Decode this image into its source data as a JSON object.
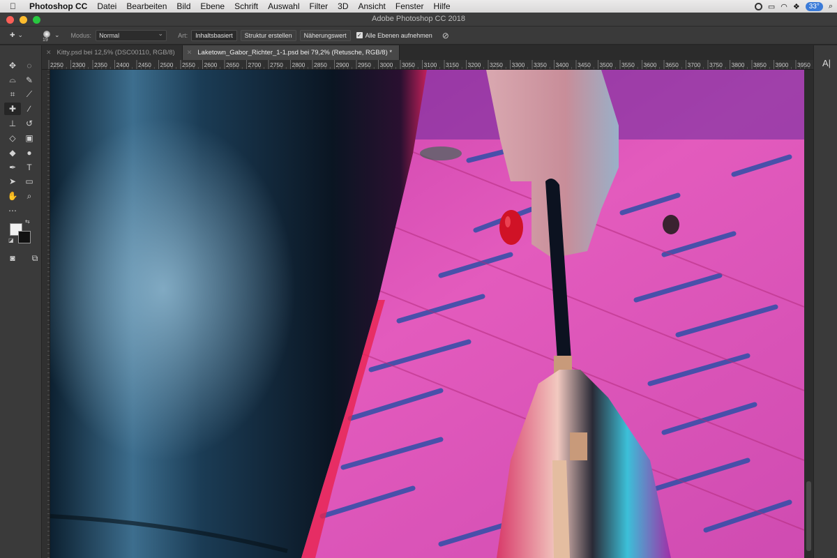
{
  "menubar": {
    "app": "Photoshop CC",
    "items": [
      "Datei",
      "Bearbeiten",
      "Bild",
      "Ebene",
      "Schrift",
      "Auswahl",
      "Filter",
      "3D",
      "Ansicht",
      "Fenster",
      "Hilfe"
    ],
    "temperature": "33°"
  },
  "window": {
    "title": "Adobe Photoshop CC 2018"
  },
  "options": {
    "brush_size": "19",
    "modus_label": "Modus:",
    "modus_value": "Normal",
    "art_label": "Art:",
    "btn_content_aware": "Inhaltsbasiert",
    "btn_create_texture": "Struktur erstellen",
    "btn_proximity": "Näherungswert",
    "sample_all_layers": "Alle Ebenen aufnehmen"
  },
  "tabs": [
    {
      "label": "Kitty.psd bei 12,5% (DSC00110, RGB/8)",
      "active": false
    },
    {
      "label": "Laketown_Gabor_Richter_1-1.psd bei 79,2% (Retusche, RGB/8) *",
      "active": true
    }
  ],
  "ruler": {
    "top_labels": [
      "2250",
      "2300",
      "2350",
      "2400",
      "2450",
      "2500",
      "2550",
      "2600",
      "2650",
      "2700",
      "2750",
      "2800",
      "2850",
      "2900",
      "2950",
      "3000",
      "3050",
      "3100",
      "3150",
      "3200",
      "3250",
      "3300",
      "3350",
      "3400",
      "3450",
      "3500",
      "3550",
      "3600",
      "3650",
      "3700",
      "3750",
      "3800",
      "3850",
      "3900",
      "3950"
    ]
  },
  "tools": [
    {
      "name": "move-tool-icon",
      "glyph": "✥"
    },
    {
      "name": "marquee-tool-icon",
      "glyph": "◌"
    },
    {
      "name": "lasso-tool-icon",
      "glyph": "⌓"
    },
    {
      "name": "quick-select-tool-icon",
      "glyph": "✎"
    },
    {
      "name": "crop-tool-icon",
      "glyph": "⌗"
    },
    {
      "name": "eyedropper-tool-icon",
      "glyph": "⟋"
    },
    {
      "name": "healing-brush-tool-icon",
      "glyph": "✚"
    },
    {
      "name": "brush-tool-icon",
      "glyph": "∕"
    },
    {
      "name": "clone-stamp-tool-icon",
      "glyph": "⊥"
    },
    {
      "name": "history-brush-tool-icon",
      "glyph": "↺"
    },
    {
      "name": "eraser-tool-icon",
      "glyph": "◇"
    },
    {
      "name": "gradient-tool-icon",
      "glyph": "▣"
    },
    {
      "name": "blur-tool-icon",
      "glyph": "◆"
    },
    {
      "name": "dodge-tool-icon",
      "glyph": "●"
    },
    {
      "name": "pen-tool-icon",
      "glyph": "✒"
    },
    {
      "name": "type-tool-icon",
      "glyph": "T"
    },
    {
      "name": "path-select-tool-icon",
      "glyph": "➤"
    },
    {
      "name": "rectangle-tool-icon",
      "glyph": "▭"
    },
    {
      "name": "hand-tool-icon",
      "glyph": "✋"
    },
    {
      "name": "zoom-tool-icon",
      "glyph": "⌕"
    },
    {
      "name": "more-tools-icon",
      "glyph": "⋯"
    },
    {
      "name": "spacer",
      "glyph": ""
    }
  ],
  "right_panel": {
    "label": "A|"
  }
}
